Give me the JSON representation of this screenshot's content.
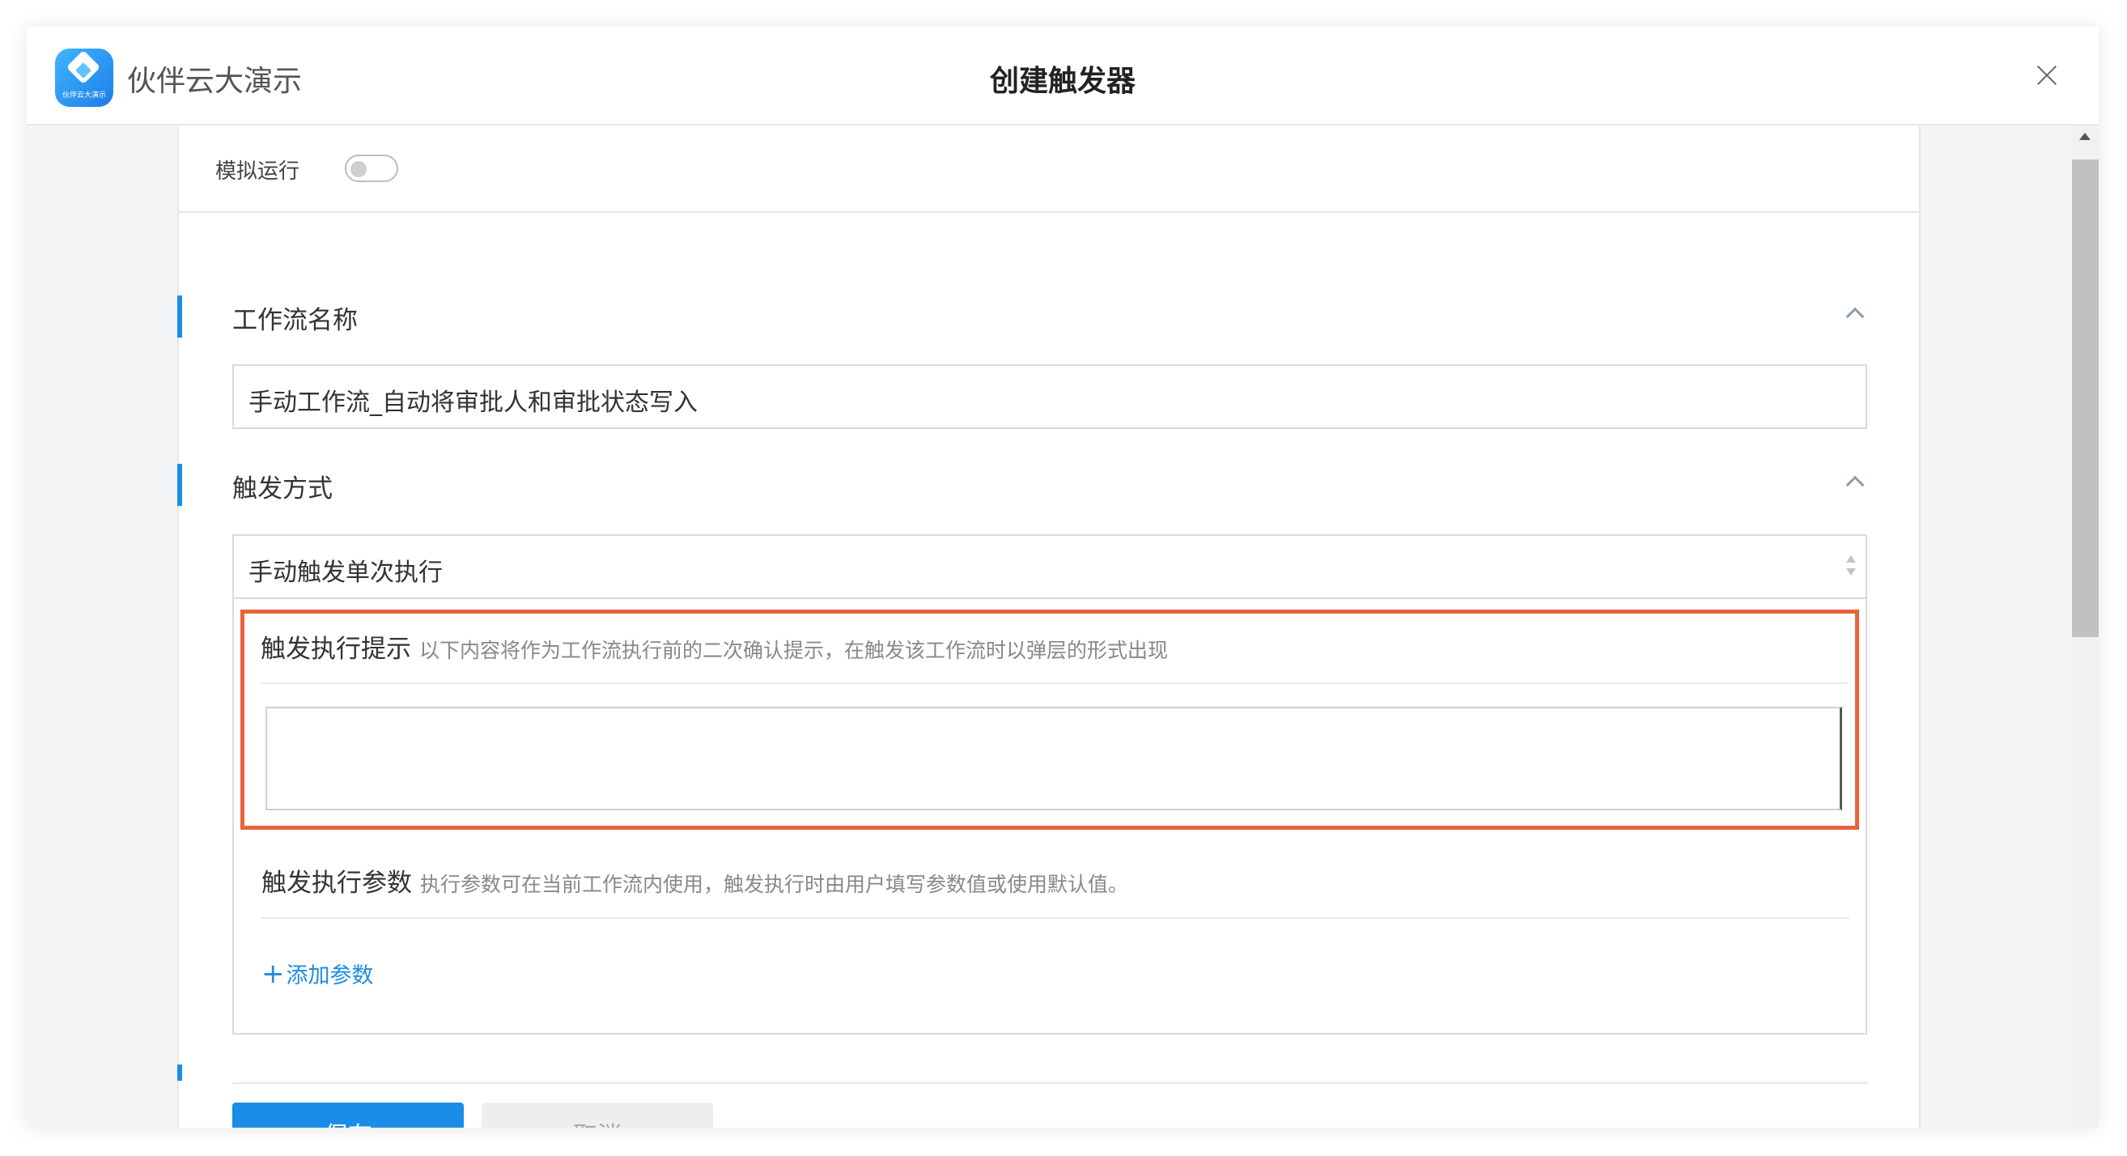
{
  "app": {
    "name": "伙伴云大演示",
    "logo_text": "伙伴云大演示"
  },
  "modal": {
    "title": "创建触发器"
  },
  "icons": {
    "close": "close-icon",
    "collapse": "chevron-up-icon",
    "select": "select-arrows-icon",
    "add": "plus-icon",
    "scroll_up": "scroll-up-arrow-icon"
  },
  "simulate": {
    "label": "模拟运行",
    "enabled": false
  },
  "workflow_name": {
    "title": "工作流名称",
    "value": "手动工作流_自动将审批人和审批状态写入"
  },
  "trigger": {
    "title": "触发方式",
    "selected": "手动触发单次执行",
    "prompt": {
      "title": "触发执行提示",
      "hint": "以下内容将作为工作流执行前的二次确认提示，在触发该工作流时以弹层的形式出现",
      "value": ""
    },
    "params": {
      "title": "触发执行参数",
      "hint": "执行参数可在当前工作流内使用，触发执行时由用户填写参数值或使用默认值。",
      "add_label": "添加参数"
    }
  },
  "footer": {
    "save_label": "保存",
    "cancel_label": "取消"
  },
  "colors": {
    "accent": "#1a8ee6",
    "highlight": "#e8643f"
  }
}
